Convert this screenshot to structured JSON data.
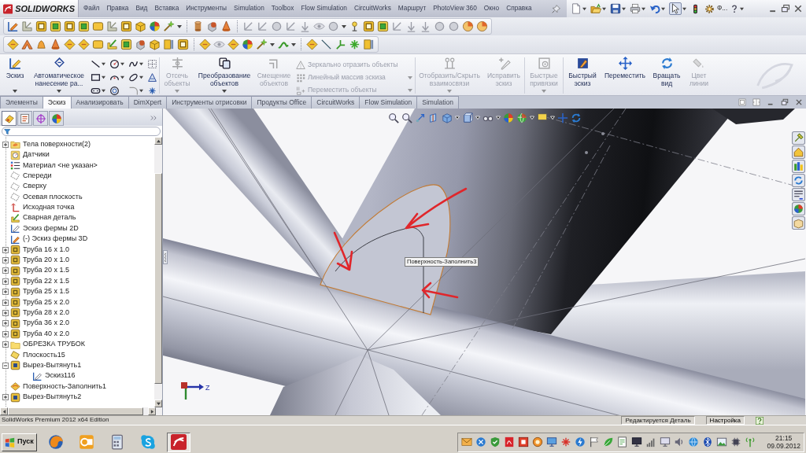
{
  "app": {
    "logo": "SOLIDWORKS"
  },
  "menu": [
    "Файл",
    "Правка",
    "Вид",
    "Вставка",
    "Инструменты",
    "Simulation",
    "Toolbox",
    "Flow Simulation",
    "CircuitWorks",
    "Маршрут",
    "PhotoView 360",
    "Окно",
    "Справка"
  ],
  "quick_access": {
    "select_pressed": true,
    "flyout_label": "Ф..."
  },
  "ribbon": {
    "groups": [
      {
        "commands": [
          {
            "kind": "large",
            "label": "Эскиз",
            "disabled": false,
            "dropdown": true
          },
          {
            "kind": "large",
            "label": "Автоматическое нанесение ра...",
            "disabled": false,
            "dropdown": true
          },
          {
            "kind": "sketch_tools"
          }
        ]
      },
      {
        "commands": [
          {
            "kind": "large",
            "label": "Отсечь объекты",
            "disabled": true,
            "dropdown": true
          },
          {
            "kind": "large",
            "label": "Преобразование объектов",
            "disabled": false,
            "dropdown": true
          },
          {
            "kind": "large",
            "label": "Смещение объектов",
            "disabled": true,
            "dropdown": false
          },
          {
            "kind": "list",
            "items": [
              {
                "label": "Зеркально отразить объекты",
                "disabled": true,
                "dropdown": false
              },
              {
                "label": "Линейный массив эскиза",
                "disabled": true,
                "dropdown": true
              },
              {
                "label": "Переместить объекты",
                "disabled": true,
                "dropdown": true
              }
            ]
          }
        ]
      },
      {
        "commands": [
          {
            "kind": "large",
            "label": "Отобразить/Скрыть взаимосвязи",
            "disabled": true,
            "dropdown": true
          },
          {
            "kind": "large",
            "label": "Исправить эскиз",
            "disabled": true,
            "dropdown": false
          }
        ]
      },
      {
        "commands": [
          {
            "kind": "large",
            "label": "Быстрые привязки",
            "disabled": true,
            "dropdown": true
          }
        ]
      },
      {
        "commands": [
          {
            "kind": "large",
            "label": "Быстрый эскиз",
            "disabled": false,
            "dropdown": false
          },
          {
            "kind": "large",
            "label": "Переместить",
            "disabled": false,
            "dropdown": false
          },
          {
            "kind": "large",
            "label": "Вращать вид",
            "disabled": false,
            "dropdown": false
          },
          {
            "kind": "large",
            "label": "Цвет линии",
            "disabled": true,
            "dropdown": false
          }
        ]
      }
    ]
  },
  "tabs": [
    {
      "label": "Элементы",
      "selected": false
    },
    {
      "label": "Эскиз",
      "selected": true
    },
    {
      "label": "Анализировать",
      "selected": false
    },
    {
      "label": "DimXpert",
      "selected": false
    },
    {
      "label": "Инструменты отрисовки",
      "selected": false
    },
    {
      "label": "Продукты Office",
      "selected": false
    },
    {
      "label": "CircuitWorks",
      "selected": false
    },
    {
      "label": "Flow Simulation",
      "selected": false
    },
    {
      "label": "Simulation",
      "selected": false
    }
  ],
  "feature_manager": {
    "panel_tabs": [
      {
        "selected": true
      },
      {
        "selected": false
      },
      {
        "selected": false
      },
      {
        "selected": false
      }
    ],
    "items": [
      {
        "label": "Тела поверхности(2)",
        "kind": "bodies",
        "expanded": false
      },
      {
        "label": "Датчики",
        "kind": "sensors"
      },
      {
        "label": "Материал <не указан>",
        "kind": "material"
      },
      {
        "label": "Спереди",
        "kind": "plane"
      },
      {
        "label": "Сверху",
        "kind": "plane"
      },
      {
        "label": "Осевая плоскость",
        "kind": "plane"
      },
      {
        "label": "Исходная точка",
        "kind": "origin"
      },
      {
        "label": "Сварная деталь",
        "kind": "weldment"
      },
      {
        "label": "Эскиз фермы 2D",
        "kind": "sketch"
      },
      {
        "label": "(-) Эскиз фермы 3D",
        "kind": "sketch3d"
      },
      {
        "label": "Труба 16 x 1.0",
        "kind": "member",
        "expanded": false
      },
      {
        "label": "Труба 20 x 1.0",
        "kind": "member",
        "expanded": false
      },
      {
        "label": "Труба 20 x 1.5",
        "kind": "member",
        "expanded": false
      },
      {
        "label": "Труба 22 x 1.5",
        "kind": "member",
        "expanded": false
      },
      {
        "label": "Труба 25 x 1.5",
        "kind": "member",
        "expanded": false
      },
      {
        "label": "Труба 25 x 2.0",
        "kind": "member",
        "expanded": false
      },
      {
        "label": "Труба 28 x 2.0",
        "kind": "member",
        "expanded": false
      },
      {
        "label": "Труба 36 x 2.0",
        "kind": "member",
        "expanded": false
      },
      {
        "label": "Труба 40 x 2.0",
        "kind": "member",
        "expanded": false
      },
      {
        "label": "ОБРЕЗКА ТРУБОК",
        "kind": "folder",
        "expanded": false
      },
      {
        "label": "Плоскость15",
        "kind": "ref_plane"
      },
      {
        "label": "Вырез-Вытянуть1",
        "kind": "cut",
        "expanded": true,
        "children": [
          {
            "label": "Эскиз116",
            "kind": "sketch"
          }
        ]
      },
      {
        "label": "Поверхность-Заполнить1",
        "kind": "fill"
      },
      {
        "label": "Вырез-Вытянуть2",
        "kind": "cut",
        "expanded": false
      }
    ]
  },
  "viewport": {
    "callout": "Поверхность-Заполнить3",
    "triad_label": "Z"
  },
  "status_bar": {
    "product": "SolidWorks Premium 2012 x64 Edition",
    "mode": "Редактируется Деталь",
    "units": "Настройка"
  },
  "taskbar": {
    "start": "Пуск",
    "quick_launch": [
      {
        "selected": false
      },
      {
        "selected": false
      },
      {
        "selected": false
      },
      {
        "selected": false
      },
      {
        "selected": true
      }
    ],
    "clock": {
      "time": "21:15",
      "date": "09.09.2012"
    }
  }
}
